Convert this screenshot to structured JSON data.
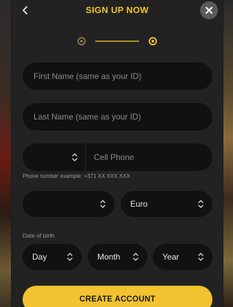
{
  "header": {
    "title": "SIGN UP NOW",
    "back_icon": "chevron-left-icon",
    "close_icon": "close-icon"
  },
  "stepper": {
    "steps": 2,
    "current_step": 2
  },
  "form": {
    "first_name": {
      "placeholder": "First Name (same as your ID)",
      "value": ""
    },
    "last_name": {
      "placeholder": "Last Name (same as your ID)",
      "value": ""
    },
    "phone": {
      "code_value": "",
      "placeholder": "Cell Phone",
      "value": "",
      "helper": "Phone number example: +371 XX XXX XXX"
    },
    "country_select": {
      "value": ""
    },
    "currency_select": {
      "value": "Euro"
    },
    "dob": {
      "label": "Date of birth",
      "day": "Day",
      "month": "Month",
      "year": "Year"
    },
    "submit_label": "CREATE ACCOUNT"
  },
  "colors": {
    "accent": "#f2c230",
    "modal_bg": "#222222",
    "field_bg": "#111111",
    "close_bg": "#5a5a5a"
  }
}
